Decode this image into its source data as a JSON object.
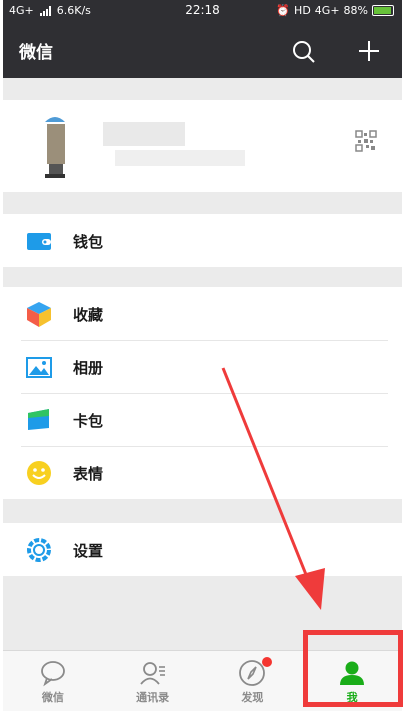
{
  "status_bar": {
    "network": "4G+",
    "speed": "6.6K/s",
    "time": "22:18",
    "hd": "HD",
    "network2": "4G+",
    "battery": "88%"
  },
  "header": {
    "title": "微信",
    "icons": [
      "search-icon",
      "plus-icon"
    ]
  },
  "profile": {
    "qr_icon": "qrcode-icon"
  },
  "menu": {
    "wallet": "钱包",
    "favorites": "收藏",
    "album": "相册",
    "cards": "卡包",
    "stickers": "表情",
    "settings": "设置"
  },
  "tabs": [
    {
      "label": "微信",
      "icon": "chat-bubble-icon"
    },
    {
      "label": "通讯录",
      "icon": "contacts-icon"
    },
    {
      "label": "发现",
      "icon": "compass-icon"
    },
    {
      "label": "我",
      "icon": "person-icon"
    }
  ],
  "colors": {
    "dark_bar": "#2f2f33",
    "active_green": "#1aad19",
    "wallet_blue": "#1e9be8",
    "annotation_red": "#ef3b3b"
  }
}
